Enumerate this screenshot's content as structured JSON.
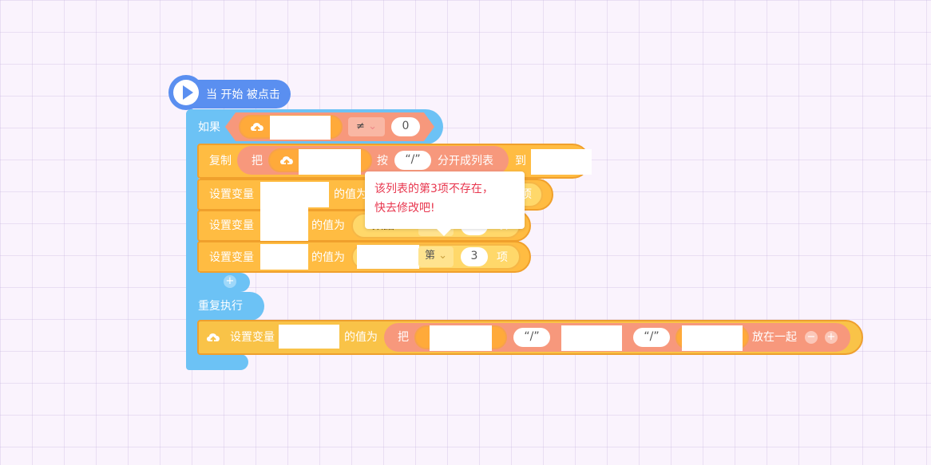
{
  "hat_block": {
    "label": "当 开始 被点击"
  },
  "if_block": {
    "label": "如果",
    "operator": "≠",
    "compare_value": "0"
  },
  "copy_block": {
    "label": "复制",
    "take_label": "把",
    "by_label": "按",
    "separator": "“/”",
    "split_label": "分开成列表",
    "to_label": "到"
  },
  "set_var_rows": [
    {
      "label": "设置变量",
      "value_label": "的值为",
      "item_prefix": "第",
      "index": "1",
      "item_suffix": "项"
    },
    {
      "label": "设置变量",
      "value_label": "的值为",
      "list_label": "数据",
      "item_prefix": "第",
      "index": "2",
      "item_suffix": "项"
    },
    {
      "label": "设置变量",
      "value_label": "的值为",
      "item_prefix": "第",
      "index": "3",
      "item_suffix": "项"
    }
  ],
  "add_branch_icon": "plus-icon",
  "repeat_block": {
    "label": "重复执行"
  },
  "join_block": {
    "label": "设置变量",
    "value_label": "的值为",
    "take_label": "把",
    "sep1": "“/”",
    "sep2": "“/”",
    "join_label": "放在一起",
    "minus_icon": "minus-icon",
    "plus_icon": "plus-icon"
  },
  "tooltip": {
    "line1": "该列表的第3项不存在，",
    "line2": "快去修改吧!"
  },
  "colors": {
    "hat": "#5a8ff0",
    "control": "#6cc2f5",
    "data_block": "#ffbc42",
    "operator": "#f7987c",
    "error_text": "#e8374f"
  }
}
